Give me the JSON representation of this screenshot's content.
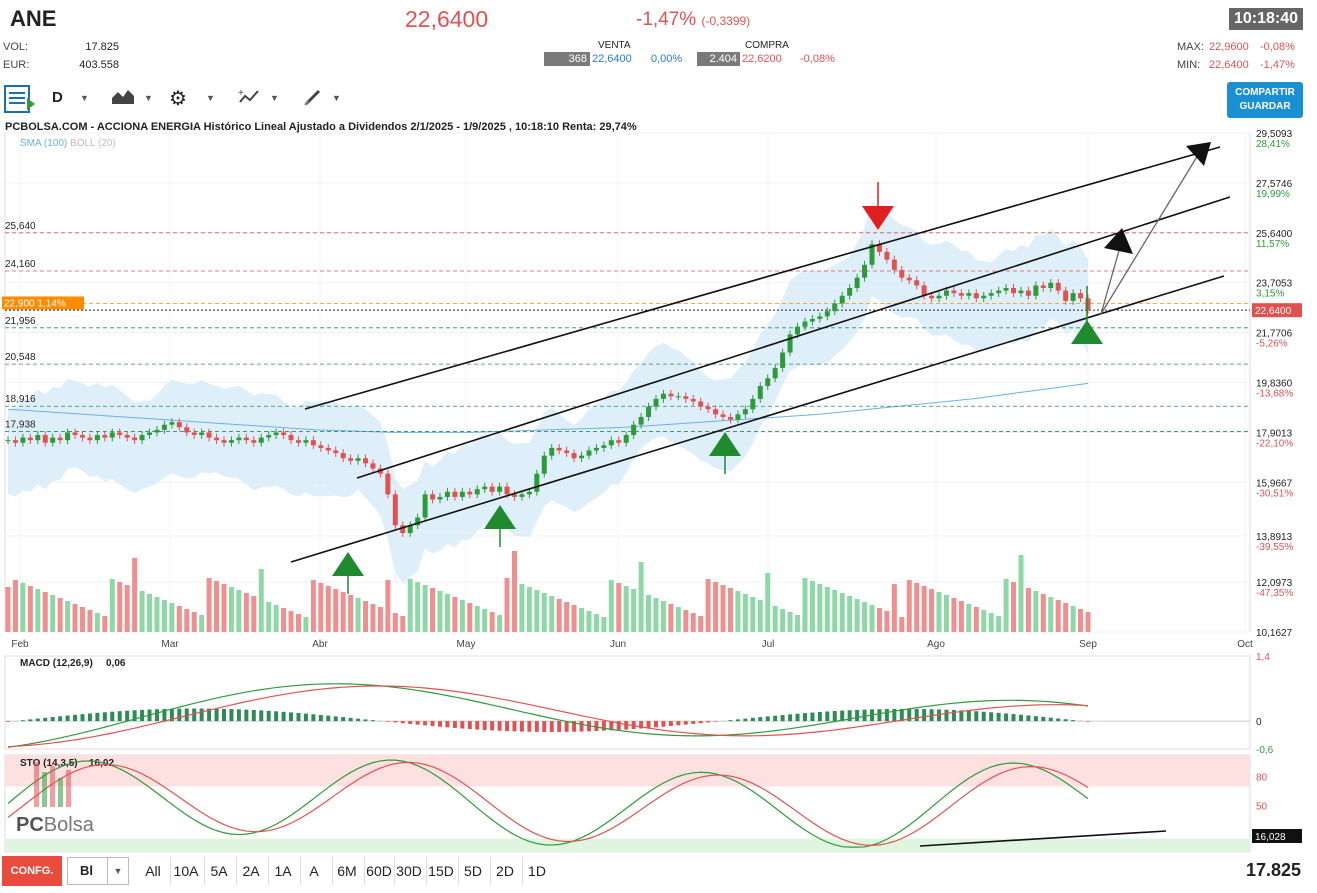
{
  "header": {
    "ticker": "ANE",
    "price": "22,6400",
    "change_pct": "-1,47%",
    "change_abs": "(-0,3399)",
    "time": "10:18:40",
    "vol_label": "VOL:",
    "vol_value": "17.825",
    "eur_label": "EUR:",
    "eur_value": "403.558",
    "venta_label": "VENTA",
    "venta_qty": "368",
    "venta_price": "22,6400",
    "venta_pct": "0,00%",
    "compra_label": "COMPRA",
    "compra_qty": "2.404",
    "compra_price": "22,6200",
    "compra_pct": "-0,08%",
    "max_label": "MAX:",
    "max_value": "22,9600",
    "max_pct": "-0,08%",
    "min_label": "MIN:",
    "min_value": "22,6400",
    "min_pct": "-1,47%"
  },
  "toolbar": {
    "period": "D",
    "share_line1": "COMPARTIR",
    "share_line2": "GUARDAR"
  },
  "chart_title": "PCBOLSA.COM - ACCIONA ENERGIA Histórico Lineal Ajustado a Dividendos 2/1/2025 - 1/9/2025 , 10:18:10 Renta: 29,74%",
  "legend": {
    "sma": "SMA (100)",
    "boll": "BOLL (20)"
  },
  "logo": {
    "pc": "PC",
    "bolsa": "Bolsa"
  },
  "bottom": {
    "conf": "CONFG.",
    "mode": "Bl",
    "ranges": [
      "All",
      "10A",
      "5A",
      "2A",
      "1A",
      "A",
      "6M",
      "60D",
      "30D",
      "15D",
      "5D",
      "2D",
      "1D"
    ],
    "volume": "17.825"
  },
  "chart_data": [
    {
      "type": "candlestick",
      "title": "PCBOLSA.COM - ACCIONA ENERGIA Histórico Lineal Ajustado a Dividendos 2/1/2025 - 1/9/2025 , 10:18:10 Renta: 29,74%",
      "x_labels": [
        "Feb",
        "Mar",
        "Abr",
        "May",
        "Jun",
        "Jul",
        "Ago",
        "Sep",
        "Oct"
      ],
      "y_ticks": [
        {
          "value": 29.5093,
          "label": "29,5093",
          "pct": "28,41%"
        },
        {
          "value": 27.5746,
          "label": "27,5746",
          "pct": "19,99%"
        },
        {
          "value": 25.64,
          "label": "25,6400",
          "pct": "11,57%"
        },
        {
          "value": 23.7053,
          "label": "23,7053",
          "pct": "3,15%"
        },
        {
          "value": 21.7706,
          "label": "21,7706",
          "pct": "-5,26%"
        },
        {
          "value": 19.836,
          "label": "19,8360",
          "pct": "-13,68%"
        },
        {
          "value": 17.9013,
          "label": "17,9013",
          "pct": "-22,10%"
        },
        {
          "value": 15.9667,
          "label": "15,9667",
          "pct": "-30,51%"
        },
        {
          "value": 13.8913,
          "label": "13,8913",
          "pct": "-39,55%"
        },
        {
          "value": 12.0973,
          "label": "12,0973",
          "pct": "-47,35%"
        },
        {
          "value": 10.1627,
          "label": "10,1627",
          "pct": ""
        }
      ],
      "ylim": [
        10.1627,
        29.5093
      ],
      "levels": [
        {
          "value": 25.64,
          "label": "25,640",
          "color": "#e05252"
        },
        {
          "value": 24.16,
          "label": "24,160",
          "color": "#e05252"
        },
        {
          "value": 22.9,
          "label": "22,900  1,14%",
          "color": "#ff8c00"
        },
        {
          "value": 21.956,
          "label": "21,956",
          "color": "#2e8b57"
        },
        {
          "value": 20.548,
          "label": "20,548",
          "color": "#2e8b57"
        },
        {
          "value": 18.916,
          "label": "18,916",
          "color": "#2e8b57"
        },
        {
          "value": 17.938,
          "label": "17,938",
          "color": "#2e8b57"
        }
      ],
      "current_price": {
        "value": 22.64,
        "label": "22,6400"
      },
      "close_series": [
        17.6,
        17.5,
        17.7,
        17.6,
        17.8,
        17.5,
        17.7,
        17.6,
        17.9,
        17.8,
        17.7,
        17.6,
        17.8,
        17.7,
        17.9,
        17.8,
        17.7,
        17.6,
        17.8,
        17.9,
        18.0,
        18.2,
        18.3,
        18.1,
        17.9,
        17.8,
        17.9,
        17.7,
        17.6,
        17.5,
        17.6,
        17.7,
        17.6,
        17.5,
        17.7,
        17.8,
        17.9,
        17.8,
        17.6,
        17.5,
        17.6,
        17.4,
        17.3,
        17.2,
        17.1,
        16.9,
        16.8,
        16.9,
        16.7,
        16.5,
        16.3,
        15.5,
        14.3,
        14.0,
        14.3,
        14.6,
        15.5,
        15.3,
        15.4,
        15.6,
        15.4,
        15.6,
        15.5,
        15.7,
        15.8,
        15.6,
        15.8,
        15.5,
        15.4,
        15.5,
        15.6,
        16.3,
        17.0,
        17.3,
        17.2,
        17.1,
        16.9,
        17.0,
        17.2,
        17.3,
        17.4,
        17.6,
        17.5,
        17.8,
        18.2,
        18.5,
        18.9,
        19.2,
        19.4,
        19.3,
        19.3,
        19.2,
        19.1,
        18.9,
        18.8,
        18.6,
        18.5,
        18.4,
        18.6,
        18.8,
        19.2,
        19.7,
        20.0,
        20.4,
        21.0,
        21.7,
        22.0,
        22.2,
        22.3,
        22.4,
        22.6,
        22.9,
        23.2,
        23.5,
        23.9,
        24.4,
        25.2,
        24.9,
        24.6,
        24.2,
        23.9,
        23.8,
        23.6,
        23.2,
        23.1,
        23.2,
        23.4,
        23.3,
        23.2,
        23.3,
        23.1,
        23.2,
        23.3,
        23.4,
        23.5,
        23.3,
        23.4,
        23.2,
        23.6,
        23.5,
        23.7,
        23.4,
        23.0,
        23.3,
        23.1,
        22.64
      ],
      "sma100": [
        18.8,
        18.7,
        18.6,
        18.5,
        18.4,
        18.3,
        18.2,
        18.1,
        18.0,
        17.95,
        17.9,
        17.9,
        17.9,
        17.95,
        18.0,
        18.05,
        18.1,
        18.2,
        18.3,
        18.4,
        18.5,
        18.6,
        18.75,
        18.9,
        19.05,
        19.2,
        19.4,
        19.6,
        19.8
      ],
      "bollinger": {
        "upper_note": "shaded band",
        "lower_note": "shaded band"
      },
      "annotations": [
        {
          "type": "arrow-down",
          "color": "red",
          "near": "Jul 25,640 peak"
        },
        {
          "type": "arrow-up",
          "color": "green",
          "near": "Abr low"
        },
        {
          "type": "arrow-up",
          "color": "green",
          "near": "May"
        },
        {
          "type": "arrow-up",
          "color": "green",
          "near": "Jun"
        },
        {
          "type": "arrow-up",
          "color": "green",
          "near": "Sep"
        },
        {
          "type": "channel",
          "lines": 3,
          "direction": "ascending"
        }
      ]
    },
    {
      "type": "macd",
      "title": "MACD (12,26,9)",
      "value": "0,06",
      "y_ticks": [
        {
          "value": 1.4,
          "label": "1,4"
        },
        {
          "value": 0,
          "label": "0"
        },
        {
          "value": -0.6,
          "label": "-0,6"
        }
      ],
      "ylim": [
        -0.6,
        1.4
      ]
    },
    {
      "type": "stochastic",
      "title": "STO (14,3,5)",
      "value": "16,02",
      "y_ticks": [
        {
          "value": 80,
          "label": "80"
        },
        {
          "value": 50,
          "label": "50"
        }
      ],
      "current": {
        "value": 16.028,
        "label": "16,028"
      },
      "ylim": [
        0,
        100
      ]
    }
  ]
}
